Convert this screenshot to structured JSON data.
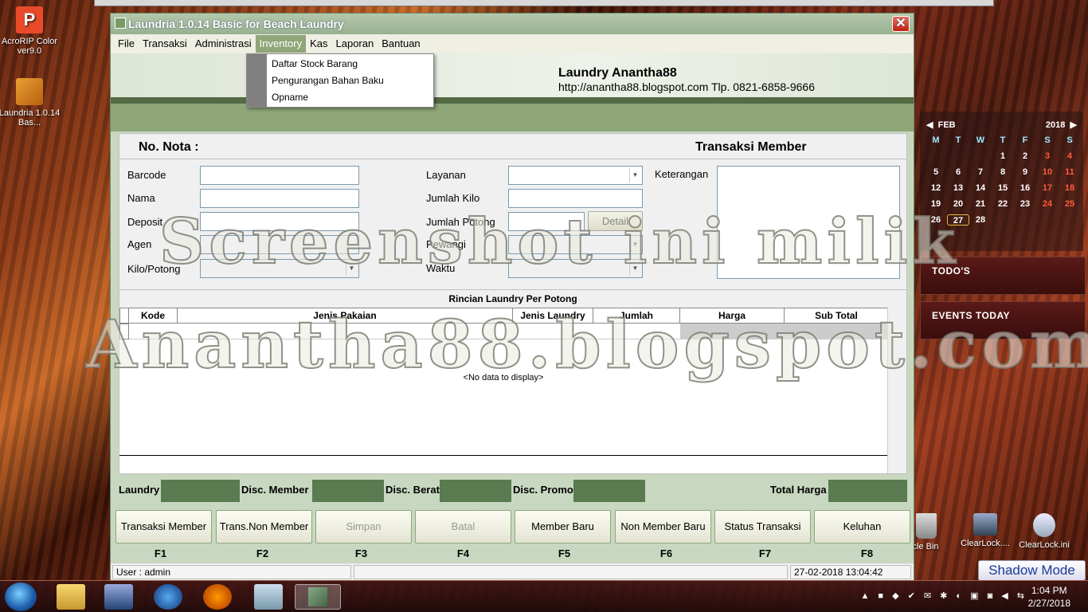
{
  "desktop": {
    "icons": [
      {
        "label": "AcroRIP Color ver9.0",
        "glyph": "P"
      },
      {
        "label": "Laundria 1.0.14 Bas..."
      },
      {
        "label": "ycle Bin"
      },
      {
        "label": "ClearLock...."
      },
      {
        "label": "ClearLock.ini"
      }
    ]
  },
  "calendar": {
    "month": "FEB",
    "year": "2018",
    "dow": [
      "M",
      "T",
      "W",
      "T",
      "F",
      "S",
      "S"
    ],
    "rows": [
      [
        "",
        "",
        "",
        "1",
        "2",
        "3",
        "4"
      ],
      [
        "5",
        "6",
        "7",
        "8",
        "9",
        "10",
        "11"
      ],
      [
        "12",
        "13",
        "14",
        "15",
        "16",
        "17",
        "18"
      ],
      [
        "19",
        "20",
        "21",
        "22",
        "23",
        "24",
        "25"
      ],
      [
        "26",
        "27",
        "28",
        "",
        "",
        "",
        ""
      ]
    ],
    "today": "27"
  },
  "gadgets": {
    "todo": "TODO'S",
    "events": "EVENTS TODAY",
    "shadow_mode": "Shadow Mode"
  },
  "window": {
    "title": "Laundria 1.0.14 Basic for Beach Laundry",
    "close": "✕",
    "menu": [
      "File",
      "Transaksi",
      "Administrasi",
      "Inventory",
      "Kas",
      "Laporan",
      "Bantuan"
    ],
    "active_menu": "Inventory",
    "dropdown": [
      "Daftar Stock Barang",
      "Pengurangan  Bahan Baku",
      "Opname"
    ],
    "banner": {
      "name": "Laundry Anantha88",
      "contact": "http://anantha88.blogspot.com Tlp. 0821-6858-9666"
    },
    "form": {
      "no_nota": "No. Nota :",
      "transaksi": "Transaksi Member",
      "barcode": "Barcode",
      "nama": "Nama",
      "deposit": "Deposit",
      "agen": "Agen",
      "kilo_potong": "Kilo/Potong",
      "layanan": "Layanan",
      "jumlah_kilo": "Jumlah Kilo",
      "jumlah_potong": "Jumlah Potong",
      "detail": "Detail",
      "pewangi": "Pewangi",
      "waktu": "Waktu",
      "keterangan": "Keterangan"
    },
    "grid": {
      "title": "Rincian Laundry Per Potong",
      "columns": [
        "Kode",
        "Jenis Pakaian",
        "Jenis Laundry",
        "Jumlah",
        "Harga",
        "Sub Total"
      ],
      "empty": "<No data to display>"
    },
    "totals": {
      "laundry": "Laundry",
      "disc_member": "Disc. Member",
      "disc_berat": "Disc. Berat",
      "disc_promo": "Disc. Promo",
      "total": "Total Harga"
    },
    "buttons": [
      {
        "label": "Transaksi Member",
        "key": "F1",
        "enabled": true
      },
      {
        "label": "Trans.Non Member",
        "key": "F2",
        "enabled": true
      },
      {
        "label": "Simpan",
        "key": "F3",
        "enabled": false
      },
      {
        "label": "Batal",
        "key": "F4",
        "enabled": false
      },
      {
        "label": "Member Baru",
        "key": "F5",
        "enabled": true
      },
      {
        "label": "Non Member Baru",
        "key": "F6",
        "enabled": true
      },
      {
        "label": "Status Transaksi",
        "key": "F7",
        "enabled": true
      },
      {
        "label": "Keluhan",
        "key": "F8",
        "enabled": true
      }
    ],
    "status": {
      "user": "User : admin",
      "datetime": "27-02-2018 13:04:42"
    }
  },
  "watermark": {
    "line1": "Screenshot ini milik",
    "line2": "Anantha88.blogspot.com"
  },
  "taskbar": {
    "time": "1:04 PM",
    "date": "2/27/2018"
  }
}
